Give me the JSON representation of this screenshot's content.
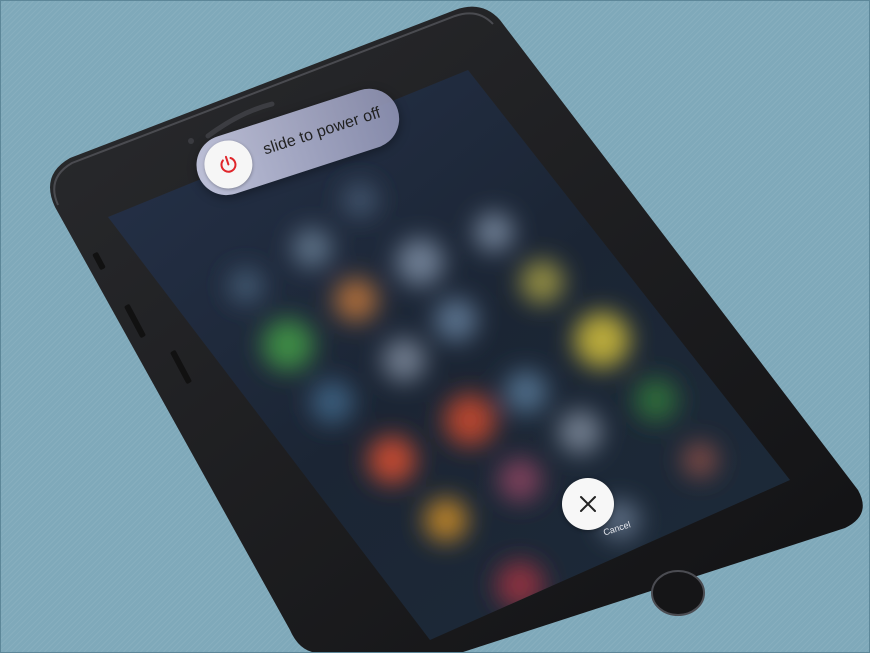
{
  "power_slider": {
    "label": "slide to power off",
    "icon": "power-icon",
    "icon_color": "#e0262b"
  },
  "cancel": {
    "label": "Cancel",
    "icon": "close-icon"
  },
  "colors": {
    "background": "#7fa9ba",
    "phone_body": "#1c1c1e",
    "screen": "#17202e"
  }
}
